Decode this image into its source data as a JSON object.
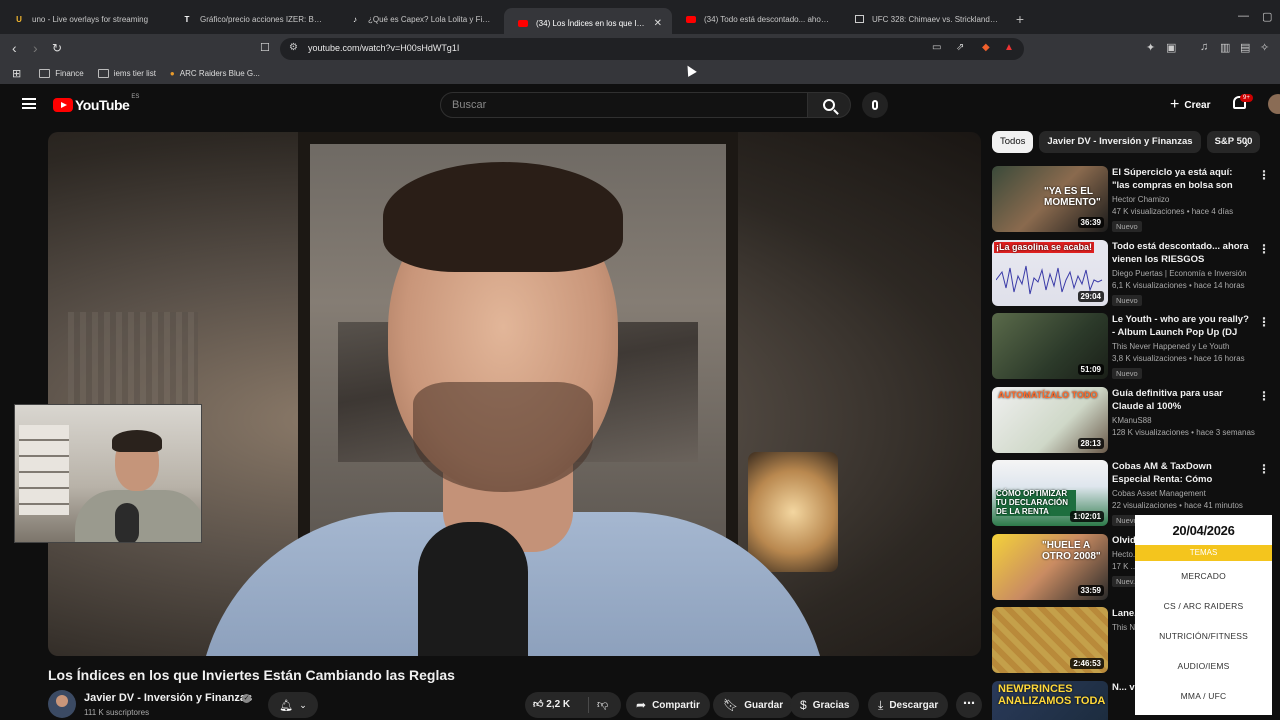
{
  "browser": {
    "tabs": [
      {
        "label": "uno - Live overlays for streaming",
        "icon": "uno-favicon",
        "active": false
      },
      {
        "label": "Gráfico/precio acciones IZER: BME:IZER",
        "icon": "tradingview-favicon",
        "active": false
      },
      {
        "label": "¿Qué es Capex? Lola Lolita y Finanzas",
        "icon": "tiktok-favicon",
        "active": false
      },
      {
        "label": "(34) Los Índices en los que Inviertes",
        "icon": "youtube-favicon",
        "active": true
      },
      {
        "label": "(34) Todo está descontado... ahora vienen",
        "icon": "youtube-favicon",
        "active": false
      },
      {
        "label": "UFC 328: Chimaev vs. Strickland | MMA",
        "icon": "page-favicon",
        "active": false
      }
    ],
    "new_tab": "+",
    "url": "youtube.com/watch?v=H00sHdWTg1I",
    "bookmarks": [
      "Finance",
      "iems tier list",
      "ARC Raiders Blue G..."
    ]
  },
  "youtube": {
    "logo_text": "YouTube",
    "country_code": "ES",
    "search_placeholder": "Buscar",
    "create_label": "Crear",
    "notif_count": "9+"
  },
  "video": {
    "title": "Los Índices en los que Inviertes Están Cambiando las Reglas",
    "channel": "Javier DV - Inversión y Finanzas",
    "subscribers": "111 K suscriptores",
    "likes": "2,2 K",
    "share_label": "Compartir",
    "save_label": "Guardar",
    "thanks_label": "Gracias",
    "download_label": "Descargar"
  },
  "chips": [
    "Todos",
    "Javier DV - Inversión y Finanzas",
    "S&P 500"
  ],
  "recommendations": [
    {
      "title": "El Súperciclo ya está aquí: \"las compras en bolsa son muy ...",
      "channel": "Hector Chamizo",
      "views": "47 K visualizaciones",
      "age": "hace 4 días",
      "duration": "36:39",
      "badge": "Nuevo",
      "thumb_text": "\"YA ES EL MOMENTO\""
    },
    {
      "title": "Todo está descontado... ahora vienen los RIESGOS",
      "channel": "Diego Puertas | Economía e Inversión",
      "views": "6,1 K visualizaciones",
      "age": "hace 14 horas",
      "duration": "29:04",
      "badge": "Nuevo",
      "thumb_text": "¡La gasolina se acaba!"
    },
    {
      "title": "Le Youth - who are you really? - Album Launch Pop Up (DJ Set)",
      "channel": "This Never Happened y Le Youth",
      "views": "3,8 K visualizaciones",
      "age": "hace 16 horas",
      "duration": "51:09",
      "badge": "Nuevo",
      "thumb_text": ""
    },
    {
      "title": "Guía definitiva para usar Claude al 100%",
      "channel": "KManuS88",
      "views": "128 K visualizaciones",
      "age": "hace 3 semanas",
      "duration": "28:13",
      "badge": "",
      "thumb_text": "AUTOMATÍZALO TODO"
    },
    {
      "title": "Cobas AM & TaxDown Especial Renta: Cómo optimizar tu ...",
      "channel": "Cobas Asset Management",
      "views": "22 visualizaciones",
      "age": "hace 41 minutos",
      "duration": "1:02:01",
      "badge": "Nuevo",
      "thumb_text": "CÓMO OPTIMIZAR TU DECLARACIÓN DE LA RENTA"
    },
    {
      "title": "Olvid... para ...",
      "channel": "Hecto...",
      "views": "17 K ...",
      "age": "",
      "duration": "33:59",
      "badge": "Nuev...",
      "thumb_text": "\"HUELE A OTRO 2008\""
    },
    {
      "title": "Lane...",
      "channel": "This N...",
      "views": "",
      "age": "",
      "duration": "2:46:53",
      "badge": "",
      "thumb_text": ""
    },
    {
      "title": "N... verd...",
      "channel": "",
      "views": "",
      "age": "",
      "duration": "",
      "badge": "",
      "thumb_text": "NEWPRINCES ANALIZAMOS TODA"
    }
  ],
  "overlay_menu": {
    "date": "20/04/2026",
    "header": "TEMAS",
    "items": [
      "MERCADO",
      "CS / ARC RAIDERS",
      "NUTRICIÓN/FITNESS",
      "AUDIO/IEMS",
      "MMA / UFC"
    ]
  },
  "colors": {
    "youtube_red": "#ff0000",
    "overlay_accent": "#f4c51d",
    "page_bg": "#0f0f0f"
  }
}
